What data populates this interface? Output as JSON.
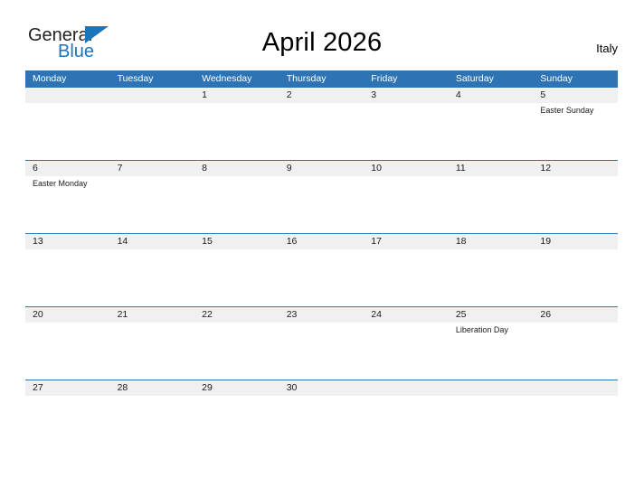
{
  "branding": {
    "logo_primary": "General",
    "logo_secondary": "Blue",
    "accent_color": "#1b75bb",
    "flag_icon": "triangle-flag-icon"
  },
  "header": {
    "title": "April 2026",
    "country": "Italy"
  },
  "theme": {
    "header_blue": "#2e74b5",
    "band_gray": "#f0f0f0",
    "text_dark": "#1a1a1a"
  },
  "calendar": {
    "weekdays": [
      "Monday",
      "Tuesday",
      "Wednesday",
      "Thursday",
      "Friday",
      "Saturday",
      "Sunday"
    ],
    "weeks": [
      [
        {
          "date": "",
          "event": ""
        },
        {
          "date": "",
          "event": ""
        },
        {
          "date": "1",
          "event": ""
        },
        {
          "date": "2",
          "event": ""
        },
        {
          "date": "3",
          "event": ""
        },
        {
          "date": "4",
          "event": ""
        },
        {
          "date": "5",
          "event": "Easter Sunday"
        }
      ],
      [
        {
          "date": "6",
          "event": "Easter Monday"
        },
        {
          "date": "7",
          "event": ""
        },
        {
          "date": "8",
          "event": ""
        },
        {
          "date": "9",
          "event": ""
        },
        {
          "date": "10",
          "event": ""
        },
        {
          "date": "11",
          "event": ""
        },
        {
          "date": "12",
          "event": ""
        }
      ],
      [
        {
          "date": "13",
          "event": ""
        },
        {
          "date": "14",
          "event": ""
        },
        {
          "date": "15",
          "event": ""
        },
        {
          "date": "16",
          "event": ""
        },
        {
          "date": "17",
          "event": ""
        },
        {
          "date": "18",
          "event": ""
        },
        {
          "date": "19",
          "event": ""
        }
      ],
      [
        {
          "date": "20",
          "event": ""
        },
        {
          "date": "21",
          "event": ""
        },
        {
          "date": "22",
          "event": ""
        },
        {
          "date": "23",
          "event": ""
        },
        {
          "date": "24",
          "event": ""
        },
        {
          "date": "25",
          "event": "Liberation Day"
        },
        {
          "date": "26",
          "event": ""
        }
      ],
      [
        {
          "date": "27",
          "event": ""
        },
        {
          "date": "28",
          "event": ""
        },
        {
          "date": "29",
          "event": ""
        },
        {
          "date": "30",
          "event": ""
        },
        {
          "date": "",
          "event": ""
        },
        {
          "date": "",
          "event": ""
        },
        {
          "date": "",
          "event": ""
        }
      ]
    ]
  }
}
